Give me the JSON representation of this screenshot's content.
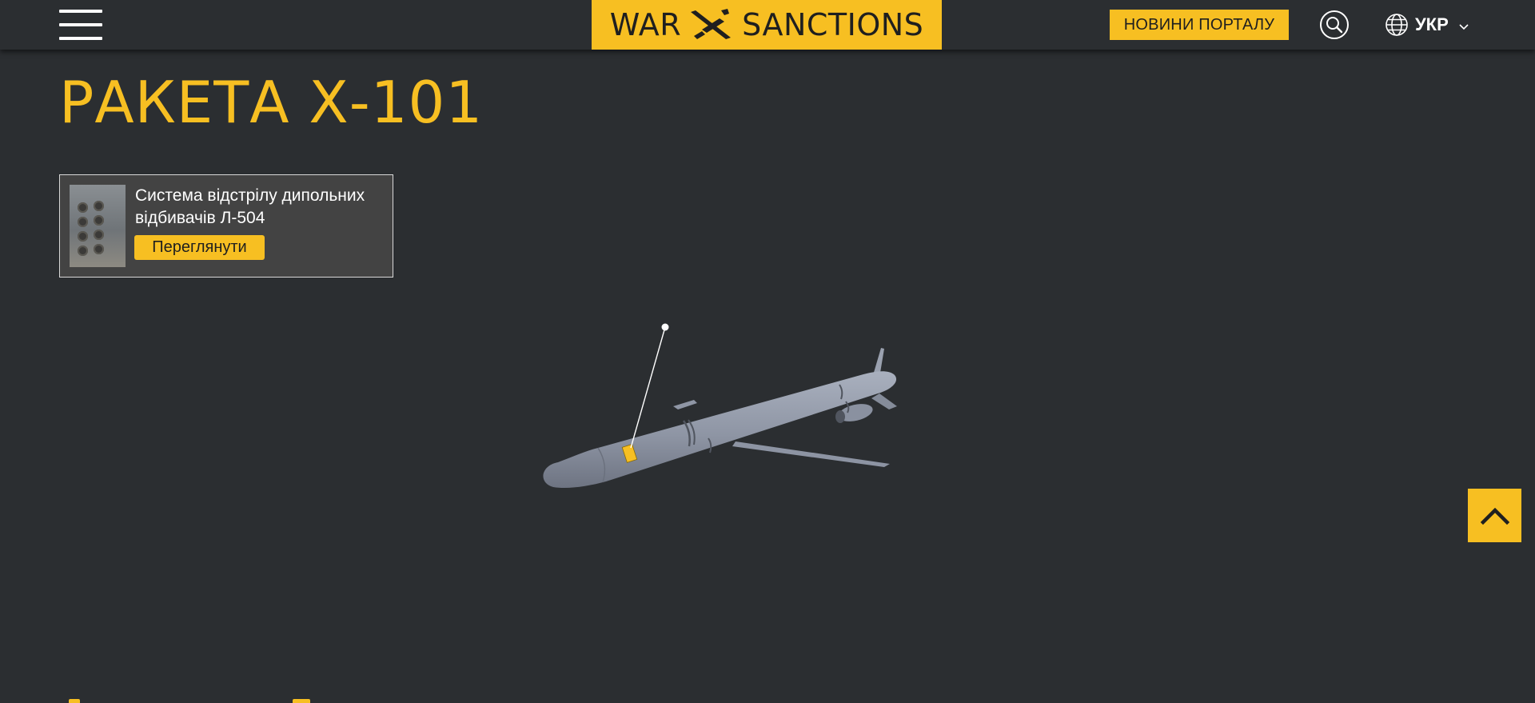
{
  "header": {
    "logo": {
      "left": "WAR",
      "right": "SANCTIONS"
    },
    "news_button": "НОВИНИ ПОРТАЛУ",
    "language": "УКР"
  },
  "page": {
    "title": "РАКЕТА Х-101"
  },
  "component_card": {
    "title": "Система відстрілу дипольних відбивачів Л-504",
    "button": "Переглянути"
  },
  "colors": {
    "accent": "#f7bf22",
    "background": "#2b2e31",
    "card_background": "#434343",
    "missile": "#8f96a5"
  },
  "icons": {
    "menu": "hamburger-icon",
    "search": "search-icon",
    "language": "globe-icon",
    "dropdown": "chevron-down-icon",
    "back_to_top": "chevron-up-icon",
    "logo": "plane-icon"
  }
}
